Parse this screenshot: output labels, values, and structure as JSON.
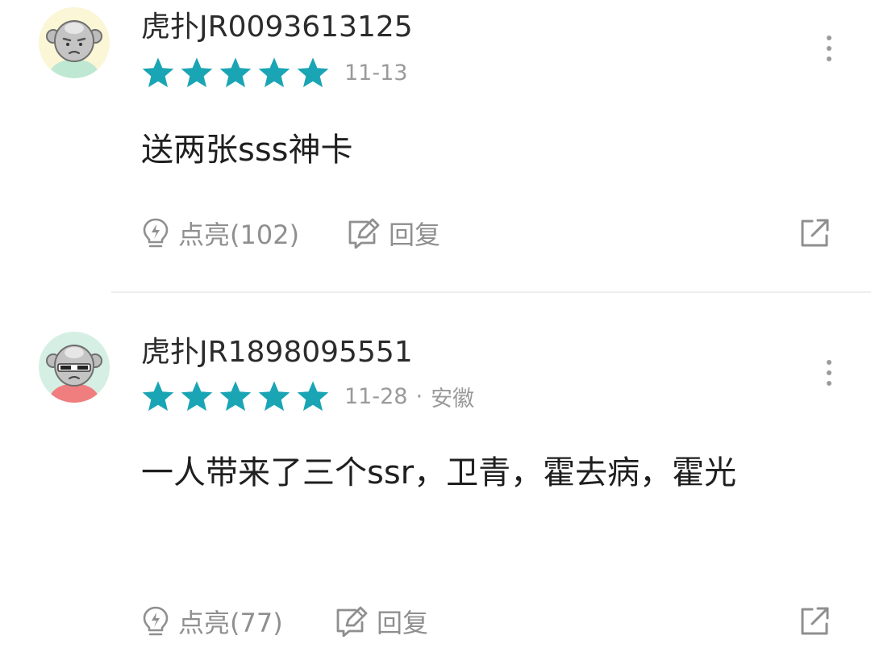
{
  "comments": [
    {
      "username": "虎扑JR0093613125",
      "rating": 5,
      "date": "11-13",
      "location": "",
      "text": "送两张sss神卡",
      "like_label": "点亮(102)",
      "reply_label": "回复",
      "avatar_style": "plain",
      "avatar_bg": "#faf6d6",
      "shirt_color": "#bfe8d3"
    },
    {
      "username": "虎扑JR1898095551",
      "rating": 5,
      "date": "11-28",
      "separator": "·",
      "location": "安徽",
      "text": "一人带来了三个ssr，卫青，霍去病，霍光",
      "like_label": "点亮(77)",
      "reply_label": "回复",
      "avatar_style": "sunglasses",
      "avatar_bg": "#d6efe4",
      "shirt_color": "#f07e7e"
    }
  ],
  "colors": {
    "star": "#1aa5b5",
    "meta_text": "#9a9a9a",
    "action_text": "#8f8f8f",
    "divider": "#eeeeee"
  },
  "icons": {
    "like": "lightbulb-icon",
    "reply": "edit-icon",
    "share": "share-icon",
    "more": "more-vertical-icon",
    "star": "star-icon"
  }
}
